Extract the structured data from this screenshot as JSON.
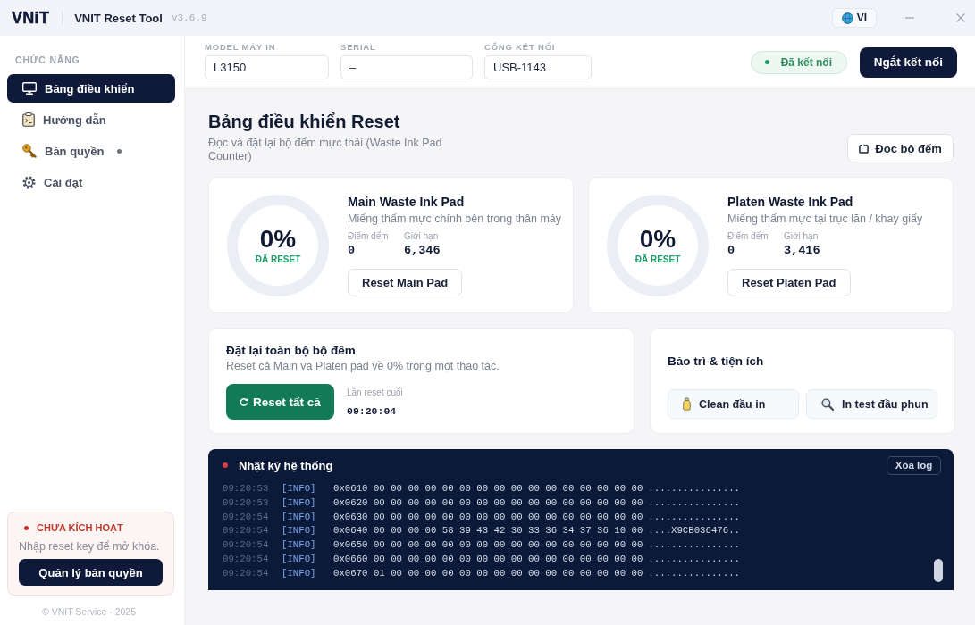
{
  "titlebar": {
    "logo": "VNiT",
    "app_name": "VNIT Reset Tool",
    "version": "v3.6.9",
    "language": "VI"
  },
  "sidebar": {
    "section_label": "CHỨC NĂNG",
    "items": [
      {
        "label": "Bảng điều khiển",
        "selected": true,
        "dot": false
      },
      {
        "label": "Hướng dẫn",
        "selected": false,
        "dot": false
      },
      {
        "label": "Bản quyền",
        "selected": false,
        "dot": true
      },
      {
        "label": "Cài đặt",
        "selected": false,
        "dot": false
      }
    ],
    "license": {
      "activated": false,
      "status": "CHƯA KÍCH HOẠT",
      "hint": "Nhập reset key để mở khóa.",
      "button": "Quản lý bản quyền"
    },
    "footer": "© VNIT Service · 2025"
  },
  "connection": {
    "fields": [
      {
        "label": "MODEL MÁY IN",
        "value": "L3150"
      },
      {
        "label": "SERIAL",
        "value": "–"
      },
      {
        "label": "CỔNG KẾT NỐI",
        "value": "USB-1143"
      }
    ],
    "status": {
      "label": "Đã kết nối",
      "connected": true
    },
    "button": "Ngắt kết nối"
  },
  "dashboard": {
    "title": "Bảng điều khiển Reset",
    "subtitle": "Đọc và đặt lại bộ đếm mực thải (Waste Ink Pad Counter)",
    "read_button": "Đọc bộ đếm",
    "pads": [
      {
        "name": "Main Waste Ink Pad",
        "description": "Miếng thấm mực chính bên trong thân máy",
        "percent": "0%",
        "percent_caption": "ĐÃ RESET",
        "count_label": "Điểm đếm",
        "count": "0",
        "limit_label": "Giới hạn",
        "limit": "6,346",
        "button": "Reset Main Pad"
      },
      {
        "name": "Platen Waste Ink Pad",
        "description": "Miếng thấm mực tại trục lăn / khay giấy",
        "percent": "0%",
        "percent_caption": "ĐÃ RESET",
        "count_label": "Điểm đếm",
        "count": "0",
        "limit_label": "Giới hạn",
        "limit": "3,416",
        "button": "Reset Platen Pad"
      }
    ],
    "reset_all": {
      "title": "Đặt lại toàn bộ bộ đếm",
      "description": "Reset cả Main và Platen pad về 0% trong một thao tác.",
      "button": "Reset tất cả",
      "last_label": "Lần reset cuối",
      "last_time": "09:20:04"
    },
    "maintenance": {
      "title": "Bảo trì & tiện ích",
      "tools": [
        {
          "label": "Clean đầu in"
        },
        {
          "label": "In test đầu phun"
        }
      ]
    }
  },
  "log": {
    "title": "Nhật ký hệ thống",
    "clear_button": "Xóa log",
    "lines": [
      {
        "time": "09:20:53",
        "tag": "[INFO]",
        "hex": "0x0610 00 00 00 00 00 00 00 00 00 00 00 00 00 00 00 00",
        "ascii": "................"
      },
      {
        "time": "09:20:53",
        "tag": "[INFO]",
        "hex": "0x0620 00 00 00 00 00 00 00 00 00 00 00 00 00 00 00 00",
        "ascii": "................"
      },
      {
        "time": "09:20:54",
        "tag": "[INFO]",
        "hex": "0x0630 00 00 00 00 00 00 00 00 00 00 00 00 00 00 00 00",
        "ascii": "................"
      },
      {
        "time": "09:20:54",
        "tag": "[INFO]",
        "hex": "0x0640 00 00 00 00 58 39 43 42 30 33 36 34 37 36 10 00",
        "ascii": "....X9CB036476.."
      },
      {
        "time": "09:20:54",
        "tag": "[INFO]",
        "hex": "0x0650 00 00 00 00 00 00 00 00 00 00 00 00 00 00 00 00",
        "ascii": "................"
      },
      {
        "time": "09:20:54",
        "tag": "[INFO]",
        "hex": "0x0660 00 00 00 00 00 00 00 00 00 00 00 00 00 00 00 00",
        "ascii": "................"
      },
      {
        "time": "09:20:54",
        "tag": "[INFO]",
        "hex": "0x0670 01 00 00 00 00 00 00 00 00 00 00 00 00 00 00 00",
        "ascii": "................"
      }
    ]
  }
}
